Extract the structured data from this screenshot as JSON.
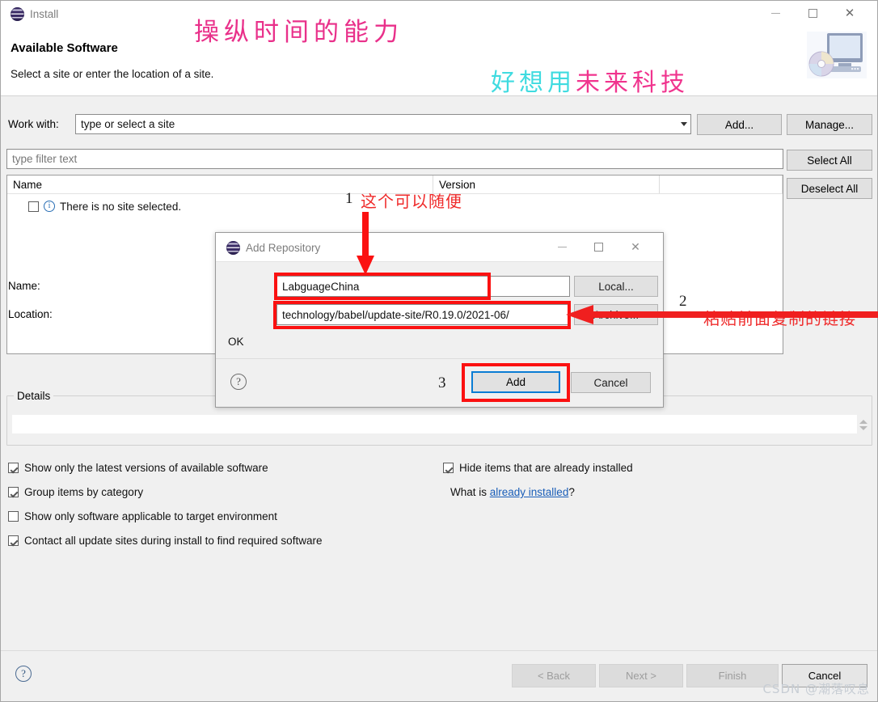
{
  "window": {
    "icon": "eclipse-logo",
    "label": "Install",
    "heading": "Available Software",
    "subheading": "Select a site or enter the location of a site.",
    "controls": {
      "minimize": "minimize-icon",
      "maximize": "maximize-icon",
      "close": "close-icon"
    },
    "graphic": "install-cd-monitor-icon"
  },
  "toolbar": {
    "work_with_label": "Work with:",
    "work_with_value": "type or select a site",
    "add_label": "Add...",
    "manage_label": "Manage...",
    "select_all_label": "Select All",
    "deselect_all_label": "Deselect All"
  },
  "filter": {
    "placeholder": "type filter text",
    "value": ""
  },
  "tree": {
    "columns": [
      "Name",
      "Version",
      ""
    ],
    "rows": [
      {
        "checked": false,
        "icon": "info-icon",
        "name": "There is no site selected.",
        "version": ""
      }
    ]
  },
  "details": {
    "legend": "Details",
    "value": "",
    "spinner": {
      "up": "spinner-up-icon",
      "down": "spinner-down-icon"
    }
  },
  "options": {
    "left": [
      {
        "label": "Show only the latest versions of available software",
        "checked": true
      },
      {
        "label": "Group items by category",
        "checked": true
      },
      {
        "label": "Show only software applicable to target environment",
        "checked": false
      },
      {
        "label": "Contact all update sites during install to find required software",
        "checked": true
      }
    ],
    "right": [
      {
        "label": "Hide items that are already installed",
        "checked": true
      }
    ],
    "already_installed_prefix": "What is ",
    "already_installed_link": "already installed",
    "already_installed_suffix": "?"
  },
  "wizard_buttons": {
    "help": "?",
    "back": "< Back",
    "next": "Next >",
    "finish": "Finish",
    "cancel": "Cancel"
  },
  "repo_dialog": {
    "icon": "eclipse-logo",
    "title": "Add Repository",
    "controls": {
      "minimize": "minimize-icon",
      "maximize": "maximize-icon",
      "close": "close-icon"
    },
    "name_label": "Name:",
    "name_value": "LabguageChina",
    "location_label": "Location:",
    "location_value": "technology/babel/update-site/R0.19.0/2021-06/",
    "local_label": "Local...",
    "archive_label": "Archive...",
    "status": "OK",
    "help": "?",
    "add_label": "Add",
    "cancel_label": "Cancel"
  },
  "annotations": {
    "top_line_1": "操纵时间的能力",
    "top_line_2_cyan": "好想用",
    "top_line_2_pink": "未来科技",
    "step1_number": "1",
    "step1_text": "这个可以随便",
    "step2_number": "2",
    "step2_text": "粘贴前面复制的链接",
    "step3_number": "3",
    "colors": {
      "pink": "#e9308a",
      "cyan": "#3fdbe0",
      "red": "#ef2b2b",
      "highlight_box": "#fb1111",
      "focus_blue": "#0a7cd4",
      "link_blue": "#1a5eb8"
    }
  },
  "watermark": "CSDN @潮落叹息"
}
